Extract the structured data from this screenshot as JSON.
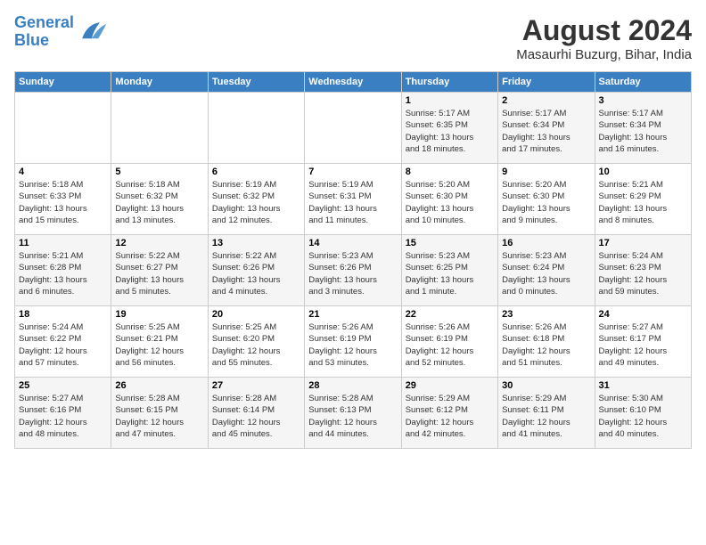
{
  "logo": {
    "line1": "General",
    "line2": "Blue"
  },
  "title": "August 2024",
  "subtitle": "Masaurhi Buzurg, Bihar, India",
  "days_of_week": [
    "Sunday",
    "Monday",
    "Tuesday",
    "Wednesday",
    "Thursday",
    "Friday",
    "Saturday"
  ],
  "weeks": [
    [
      {
        "day": "",
        "info": ""
      },
      {
        "day": "",
        "info": ""
      },
      {
        "day": "",
        "info": ""
      },
      {
        "day": "",
        "info": ""
      },
      {
        "day": "1",
        "info": "Sunrise: 5:17 AM\nSunset: 6:35 PM\nDaylight: 13 hours\nand 18 minutes."
      },
      {
        "day": "2",
        "info": "Sunrise: 5:17 AM\nSunset: 6:34 PM\nDaylight: 13 hours\nand 17 minutes."
      },
      {
        "day": "3",
        "info": "Sunrise: 5:17 AM\nSunset: 6:34 PM\nDaylight: 13 hours\nand 16 minutes."
      }
    ],
    [
      {
        "day": "4",
        "info": "Sunrise: 5:18 AM\nSunset: 6:33 PM\nDaylight: 13 hours\nand 15 minutes."
      },
      {
        "day": "5",
        "info": "Sunrise: 5:18 AM\nSunset: 6:32 PM\nDaylight: 13 hours\nand 13 minutes."
      },
      {
        "day": "6",
        "info": "Sunrise: 5:19 AM\nSunset: 6:32 PM\nDaylight: 13 hours\nand 12 minutes."
      },
      {
        "day": "7",
        "info": "Sunrise: 5:19 AM\nSunset: 6:31 PM\nDaylight: 13 hours\nand 11 minutes."
      },
      {
        "day": "8",
        "info": "Sunrise: 5:20 AM\nSunset: 6:30 PM\nDaylight: 13 hours\nand 10 minutes."
      },
      {
        "day": "9",
        "info": "Sunrise: 5:20 AM\nSunset: 6:30 PM\nDaylight: 13 hours\nand 9 minutes."
      },
      {
        "day": "10",
        "info": "Sunrise: 5:21 AM\nSunset: 6:29 PM\nDaylight: 13 hours\nand 8 minutes."
      }
    ],
    [
      {
        "day": "11",
        "info": "Sunrise: 5:21 AM\nSunset: 6:28 PM\nDaylight: 13 hours\nand 6 minutes."
      },
      {
        "day": "12",
        "info": "Sunrise: 5:22 AM\nSunset: 6:27 PM\nDaylight: 13 hours\nand 5 minutes."
      },
      {
        "day": "13",
        "info": "Sunrise: 5:22 AM\nSunset: 6:26 PM\nDaylight: 13 hours\nand 4 minutes."
      },
      {
        "day": "14",
        "info": "Sunrise: 5:23 AM\nSunset: 6:26 PM\nDaylight: 13 hours\nand 3 minutes."
      },
      {
        "day": "15",
        "info": "Sunrise: 5:23 AM\nSunset: 6:25 PM\nDaylight: 13 hours\nand 1 minute."
      },
      {
        "day": "16",
        "info": "Sunrise: 5:23 AM\nSunset: 6:24 PM\nDaylight: 13 hours\nand 0 minutes."
      },
      {
        "day": "17",
        "info": "Sunrise: 5:24 AM\nSunset: 6:23 PM\nDaylight: 12 hours\nand 59 minutes."
      }
    ],
    [
      {
        "day": "18",
        "info": "Sunrise: 5:24 AM\nSunset: 6:22 PM\nDaylight: 12 hours\nand 57 minutes."
      },
      {
        "day": "19",
        "info": "Sunrise: 5:25 AM\nSunset: 6:21 PM\nDaylight: 12 hours\nand 56 minutes."
      },
      {
        "day": "20",
        "info": "Sunrise: 5:25 AM\nSunset: 6:20 PM\nDaylight: 12 hours\nand 55 minutes."
      },
      {
        "day": "21",
        "info": "Sunrise: 5:26 AM\nSunset: 6:19 PM\nDaylight: 12 hours\nand 53 minutes."
      },
      {
        "day": "22",
        "info": "Sunrise: 5:26 AM\nSunset: 6:19 PM\nDaylight: 12 hours\nand 52 minutes."
      },
      {
        "day": "23",
        "info": "Sunrise: 5:26 AM\nSunset: 6:18 PM\nDaylight: 12 hours\nand 51 minutes."
      },
      {
        "day": "24",
        "info": "Sunrise: 5:27 AM\nSunset: 6:17 PM\nDaylight: 12 hours\nand 49 minutes."
      }
    ],
    [
      {
        "day": "25",
        "info": "Sunrise: 5:27 AM\nSunset: 6:16 PM\nDaylight: 12 hours\nand 48 minutes."
      },
      {
        "day": "26",
        "info": "Sunrise: 5:28 AM\nSunset: 6:15 PM\nDaylight: 12 hours\nand 47 minutes."
      },
      {
        "day": "27",
        "info": "Sunrise: 5:28 AM\nSunset: 6:14 PM\nDaylight: 12 hours\nand 45 minutes."
      },
      {
        "day": "28",
        "info": "Sunrise: 5:28 AM\nSunset: 6:13 PM\nDaylight: 12 hours\nand 44 minutes."
      },
      {
        "day": "29",
        "info": "Sunrise: 5:29 AM\nSunset: 6:12 PM\nDaylight: 12 hours\nand 42 minutes."
      },
      {
        "day": "30",
        "info": "Sunrise: 5:29 AM\nSunset: 6:11 PM\nDaylight: 12 hours\nand 41 minutes."
      },
      {
        "day": "31",
        "info": "Sunrise: 5:30 AM\nSunset: 6:10 PM\nDaylight: 12 hours\nand 40 minutes."
      }
    ]
  ]
}
